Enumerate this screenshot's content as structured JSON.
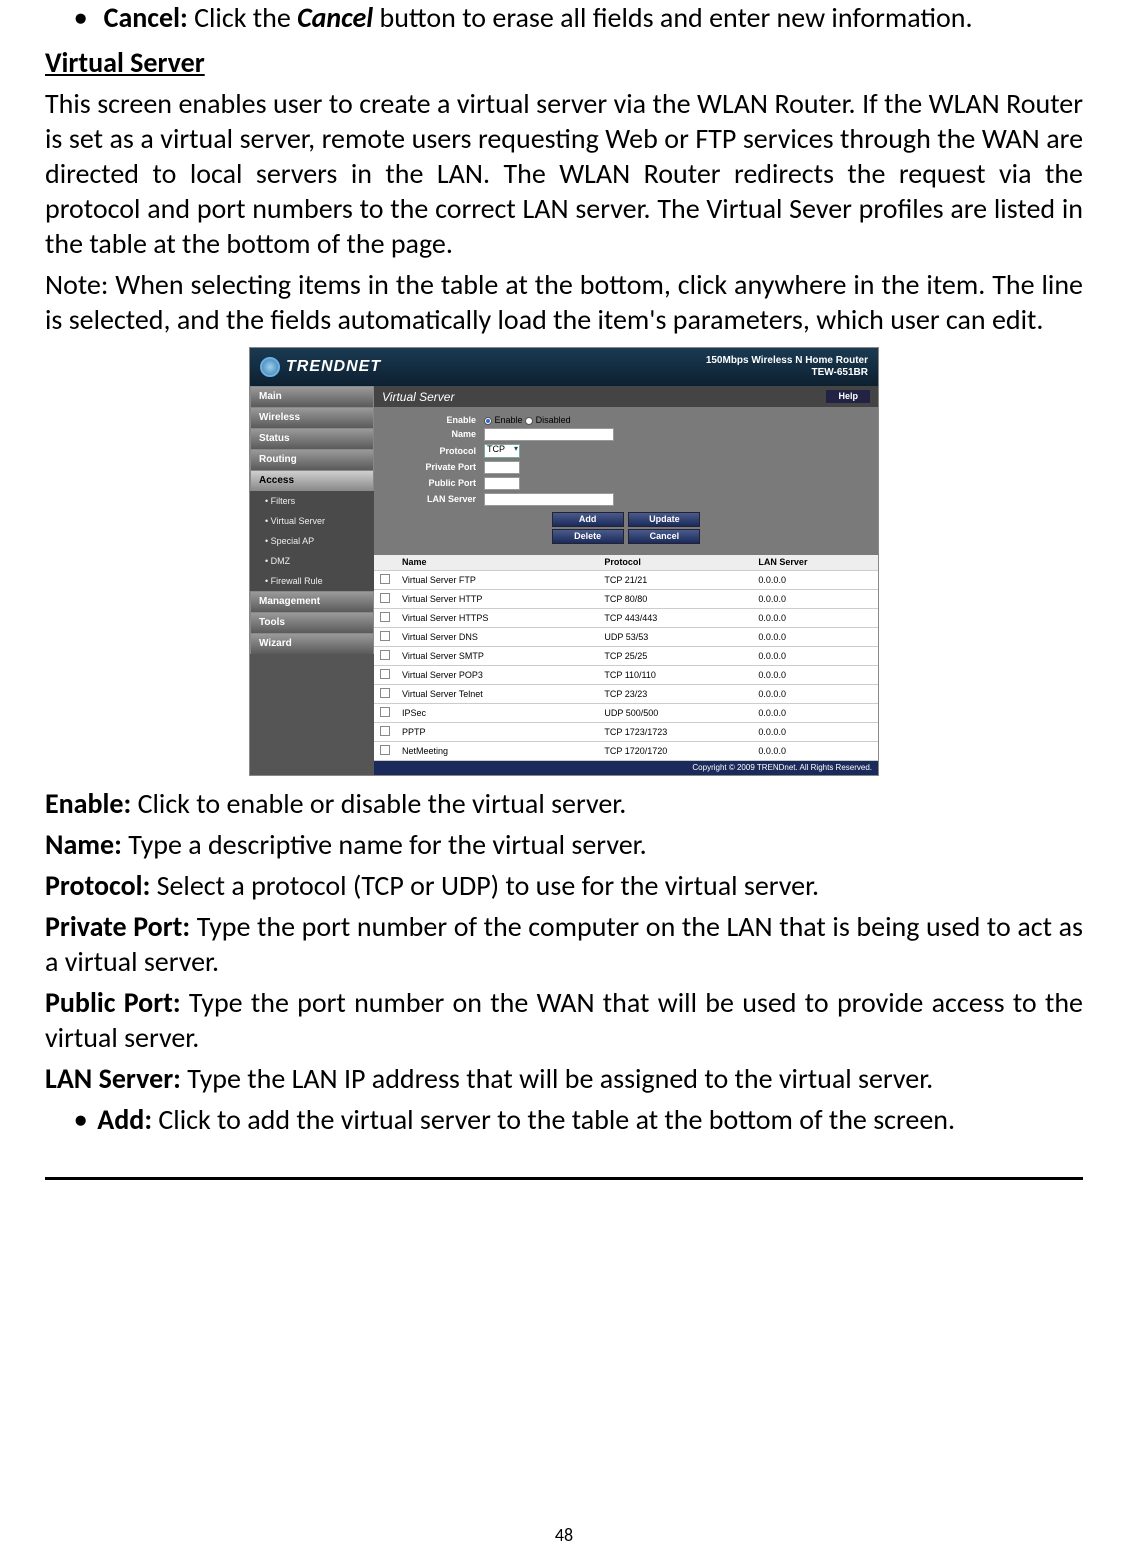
{
  "intro_bullet": {
    "label": "Cancel:",
    "button_name": "Cancel",
    "rest": " button to erase all fields and enter new information."
  },
  "section_heading": "Virtual Server",
  "para1": "This screen enables user to create a virtual server via the WLAN Router. If the WLAN Router is set as a virtual server, remote users requesting Web or FTP services through the WAN are directed to local servers in the LAN. The WLAN Router redirects the request via the protocol and port numbers to the correct LAN server. The Virtual Sever profiles are listed in the table at the bottom of the page.",
  "para2": "Note: When selecting items in the table at the bottom, click anywhere in the item. The line is selected, and the fields automatically load the item's parameters, which user can edit.",
  "screenshot": {
    "brand": "TRENDNET",
    "product_line1": "150Mbps Wireless N Home Router",
    "product_line2": "TEW-651BR",
    "nav": [
      "Main",
      "Wireless",
      "Status",
      "Routing",
      "Access"
    ],
    "sub_nav": [
      "Filters",
      "Virtual Server",
      "Special AP",
      "DMZ",
      "Firewall Rule"
    ],
    "nav_after": [
      "Management",
      "Tools",
      "Wizard"
    ],
    "panel_title": "Virtual Server",
    "help": "Help",
    "form_labels": {
      "enable": "Enable",
      "name": "Name",
      "protocol": "Protocol",
      "private_port": "Private Port",
      "public_port": "Public Port",
      "lan_server": "LAN Server"
    },
    "enable_opts": {
      "on": "Enable",
      "off": "Disabled"
    },
    "protocol_value": "TCP",
    "buttons": {
      "add": "Add",
      "update": "Update",
      "delete": "Delete",
      "cancel": "Cancel"
    },
    "table_headers": {
      "name": "Name",
      "protocol": "Protocol",
      "lan": "LAN Server"
    },
    "rows": [
      {
        "name": "Virtual Server FTP",
        "proto": "TCP 21/21",
        "lan": "0.0.0.0"
      },
      {
        "name": "Virtual Server HTTP",
        "proto": "TCP 80/80",
        "lan": "0.0.0.0"
      },
      {
        "name": "Virtual Server HTTPS",
        "proto": "TCP 443/443",
        "lan": "0.0.0.0"
      },
      {
        "name": "Virtual Server DNS",
        "proto": "UDP 53/53",
        "lan": "0.0.0.0"
      },
      {
        "name": "Virtual Server SMTP",
        "proto": "TCP 25/25",
        "lan": "0.0.0.0"
      },
      {
        "name": "Virtual Server POP3",
        "proto": "TCP 110/110",
        "lan": "0.0.0.0"
      },
      {
        "name": "Virtual Server Telnet",
        "proto": "TCP 23/23",
        "lan": "0.0.0.0"
      },
      {
        "name": "IPSec",
        "proto": "UDP 500/500",
        "lan": "0.0.0.0"
      },
      {
        "name": "PPTP",
        "proto": "TCP 1723/1723",
        "lan": "0.0.0.0"
      },
      {
        "name": "NetMeeting",
        "proto": "TCP 1720/1720",
        "lan": "0.0.0.0"
      }
    ],
    "copyright": "Copyright © 2009 TRENDnet. All Rights Reserved."
  },
  "desc": {
    "enable": {
      "l": "Enable:",
      "t": " Click to enable or disable the virtual server."
    },
    "name": {
      "l": "Name:",
      "t": " Type a descriptive name for the virtual server."
    },
    "protocol": {
      "l": "Protocol:",
      "t": " Select a protocol (TCP or UDP) to use for the virtual server."
    },
    "private": {
      "l": "Private Port:",
      "t": " Type the port number of the computer on the LAN that is being used to act as a virtual server."
    },
    "public": {
      "l": "Public Port:",
      "t": " Type the port number on the WAN that will be used to provide access to the virtual server."
    },
    "lan": {
      "l": "LAN Server:",
      "t": " Type the LAN IP address that will be assigned to the virtual server."
    },
    "add_bullet": {
      "l": "Add:",
      "t": " Click to add the virtual server to the table at the bottom of the screen."
    }
  },
  "page_number": "48"
}
